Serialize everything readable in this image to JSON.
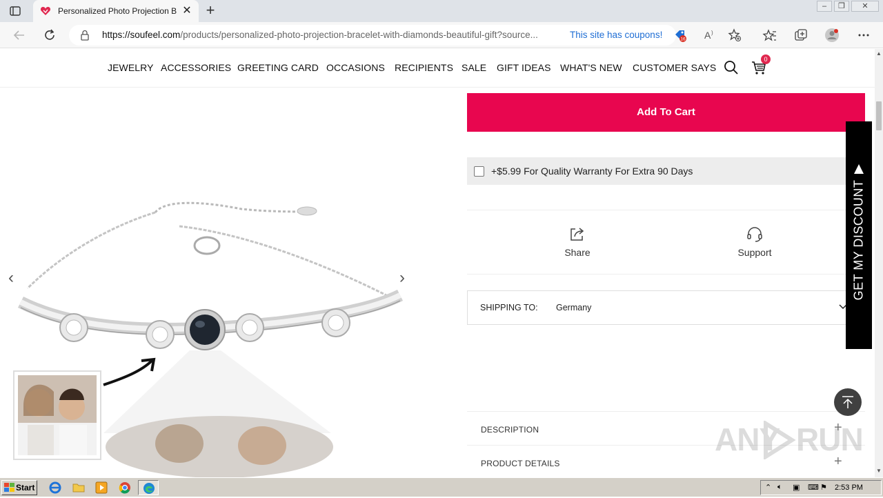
{
  "browser": {
    "tab_title": "Personalized Photo Projection Bracelet with Diamonds Beautiful Gift",
    "tab_close": "✕",
    "new_tab": "+",
    "url_domain": "https://soufeel.com",
    "url_path": "/products/personalized-photo-projection-bracelet-with-diamonds-beautiful-gift?source...",
    "coupons_text": "This site has coupons!",
    "coupon_badge": "16"
  },
  "site_nav": {
    "items": [
      "JEWELRY",
      "ACCESSORIES",
      "GREETING CARD",
      "OCCASIONS",
      "RECIPIENTS",
      "SALE",
      "GIFT IDEAS",
      "WHAT'S NEW",
      "CUSTOMER SAYS"
    ],
    "cart_count": "0"
  },
  "gallery": {
    "prev": "‹",
    "next": "›"
  },
  "product": {
    "add_to_cart": "Add To Cart",
    "warranty_text": "+$5.99 For Quality Warranty For Extra 90 Days",
    "share_label": "Share",
    "support_label": "Support",
    "shipping_label": "SHIPPING TO:",
    "shipping_country": "Germany",
    "accordions": [
      "DESCRIPTION",
      "PRODUCT DETAILS"
    ],
    "accordion_icon": "+"
  },
  "discount_tab": "GET MY DISCOUNT",
  "watermark": {
    "left": "ANY",
    "right": "RUN"
  },
  "taskbar": {
    "start": "Start",
    "clock": "2:53 PM"
  },
  "colors": {
    "accent": "#e8064f",
    "discount_bg": "#000000"
  }
}
